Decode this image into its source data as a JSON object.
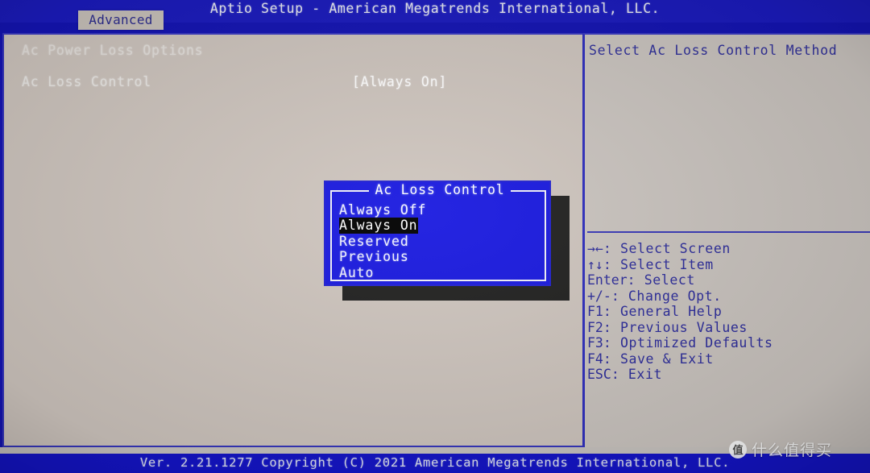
{
  "header": {
    "title": "Aptio Setup - American Megatrends International, LLC.",
    "tab_label": "Advanced"
  },
  "main": {
    "section_title": "Ac Power Loss Options",
    "setting_label": "Ac Loss Control",
    "setting_value": "[Always On]"
  },
  "help": {
    "text": "Select Ac Loss Control Method",
    "keys": [
      {
        "glyph": "→←",
        "text": ": Select Screen"
      },
      {
        "glyph": "↑↓",
        "text": ": Select Item"
      },
      {
        "glyph": "Enter",
        "text": ": Select"
      },
      {
        "glyph": "+/-",
        "text": ": Change Opt."
      },
      {
        "glyph": "F1",
        "text": ": General Help"
      },
      {
        "glyph": "F2",
        "text": ": Previous Values"
      },
      {
        "glyph": "F3",
        "text": ": Optimized Defaults"
      },
      {
        "glyph": "F4",
        "text": ": Save & Exit"
      },
      {
        "glyph": "ESC",
        "text": ": Exit"
      }
    ]
  },
  "dialog": {
    "title": "Ac Loss Control",
    "options": [
      {
        "label": "Always Off",
        "selected": false
      },
      {
        "label": "Always On",
        "selected": true
      },
      {
        "label": "Reserved",
        "selected": false
      },
      {
        "label": "Previous",
        "selected": false
      },
      {
        "label": "Auto",
        "selected": false
      }
    ]
  },
  "footer": {
    "text": "Ver. 2.21.1277 Copyright (C) 2021 American Megatrends International, LLC."
  },
  "watermark": {
    "logo": "值",
    "text": "什么值得买"
  },
  "colors": {
    "bios_blue": "#1414c8",
    "panel_bg": "#cdc4bd",
    "dialog_blue": "#1a1ae0",
    "help_text": "#2d2d9c",
    "selection_bg": "#000000"
  }
}
